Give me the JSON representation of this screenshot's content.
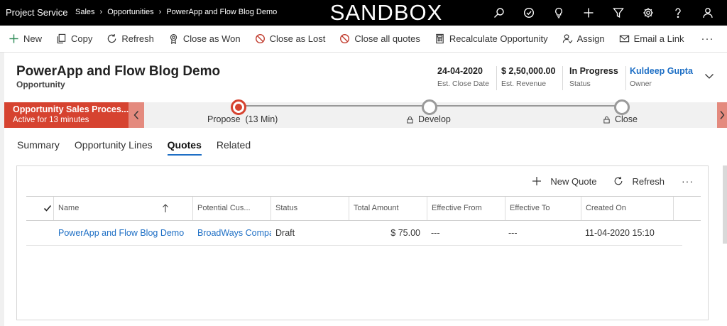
{
  "topbar": {
    "app_name": "Project Service",
    "breadcrumbs": [
      "Sales",
      "Opportunities",
      "PowerApp and Flow Blog Demo"
    ],
    "environment": "SANDBOX",
    "icons": [
      "search-icon",
      "activity-check-icon",
      "lightbulb-icon",
      "plus-icon",
      "filter-icon",
      "settings-icon",
      "help-icon",
      "user-icon"
    ]
  },
  "commands": [
    {
      "label": "New",
      "icon": "plus-icon"
    },
    {
      "label": "Copy",
      "icon": "copy-icon"
    },
    {
      "label": "Refresh",
      "icon": "refresh-icon"
    },
    {
      "label": "Close as Won",
      "icon": "award-icon"
    },
    {
      "label": "Close as Lost",
      "icon": "block-icon"
    },
    {
      "label": "Close all quotes",
      "icon": "block-icon"
    },
    {
      "label": "Recalculate Opportunity",
      "icon": "calculator-icon"
    },
    {
      "label": "Assign",
      "icon": "assign-icon"
    },
    {
      "label": "Email a Link",
      "icon": "email-icon"
    }
  ],
  "more_label": "···",
  "header": {
    "title": "PowerApp and Flow Blog Demo",
    "entity": "Opportunity",
    "fields": [
      {
        "value": "24-04-2020",
        "label": "Est. Close Date"
      },
      {
        "value": "$ 2,50,000.00",
        "label": "Est. Revenue"
      },
      {
        "value": "In Progress",
        "label": "Status"
      },
      {
        "value": "Kuldeep Gupta",
        "label": "Owner"
      }
    ]
  },
  "bpf": {
    "process_name": "Opportunity Sales Proces...",
    "active_for": "Active for 13 minutes",
    "stages": [
      {
        "label": "Propose  (13 Min)",
        "state": "active"
      },
      {
        "label": "Develop",
        "state": "locked"
      },
      {
        "label": "Close",
        "state": "locked"
      }
    ]
  },
  "tabs": [
    {
      "label": "Summary",
      "active": false
    },
    {
      "label": "Opportunity Lines",
      "active": false
    },
    {
      "label": "Quotes",
      "active": true
    },
    {
      "label": "Related",
      "active": false
    }
  ],
  "grid": {
    "toolbar": {
      "new_label": "New Quote",
      "refresh_label": "Refresh"
    },
    "columns": [
      "Name",
      "Potential Cus...",
      "Status",
      "Total Amount",
      "Effective From",
      "Effective To",
      "Created On"
    ],
    "rows": [
      {
        "name": "PowerApp and Flow Blog Demo",
        "customer": "BroadWays Compa",
        "status": "Draft",
        "total": "$ 75.00",
        "effective_from": "---",
        "effective_to": "---",
        "created_on": "11-04-2020 15:10"
      }
    ]
  },
  "colors": {
    "accent": "#1e6fc5",
    "stage_active": "#d64330",
    "topbar": "#000000"
  }
}
